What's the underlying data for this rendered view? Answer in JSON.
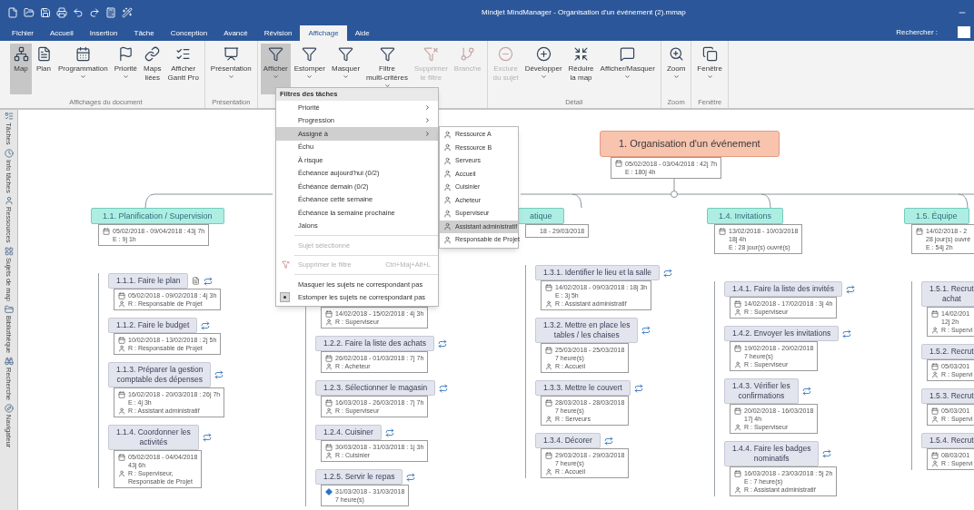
{
  "window": {
    "title": "Mindjet MindManager - Organisation d'un événement (2).mmap"
  },
  "menu_tabs": [
    {
      "label": "Fichier",
      "selected": false
    },
    {
      "label": "Accueil",
      "selected": false
    },
    {
      "label": "Insertion",
      "selected": false
    },
    {
      "label": "Tâche",
      "selected": false
    },
    {
      "label": "Conception",
      "selected": false
    },
    {
      "label": "Avancé",
      "selected": false
    },
    {
      "label": "Révision",
      "selected": false
    },
    {
      "label": "Affichage",
      "selected": true
    },
    {
      "label": "Aide",
      "selected": false
    }
  ],
  "search": {
    "label": "Rechercher :"
  },
  "ribbon": {
    "groups": [
      {
        "label": "Affichages du document",
        "buttons": [
          {
            "label": "Map",
            "dropdown": false,
            "selected": true,
            "disabled": false
          },
          {
            "label": "Plan",
            "dropdown": false,
            "selected": false,
            "disabled": false
          },
          {
            "label": "Programmation",
            "dropdown": true,
            "selected": false,
            "disabled": false
          },
          {
            "label": "Priorité",
            "dropdown": true,
            "selected": false,
            "disabled": false
          },
          {
            "label": "Maps\nliées",
            "dropdown": false,
            "selected": false,
            "disabled": false
          },
          {
            "label": "Afficher\nGantt Pro",
            "dropdown": false,
            "selected": false,
            "disabled": false
          }
        ]
      },
      {
        "label": "Présentation",
        "buttons": [
          {
            "label": "Présentation",
            "dropdown": true,
            "selected": false,
            "disabled": false
          }
        ]
      },
      {
        "buttons": [
          {
            "label": "Afficher",
            "dropdown": true,
            "selected": true,
            "disabled": false
          },
          {
            "label": "Estomper",
            "dropdown": true,
            "selected": false,
            "disabled": false
          },
          {
            "label": "Masquer",
            "dropdown": true,
            "selected": false,
            "disabled": false
          },
          {
            "label": "Filtre\nmulti-critères",
            "dropdown": true,
            "selected": false,
            "disabled": false
          },
          {
            "label": "Supprimer\nle filtre",
            "dropdown": false,
            "selected": false,
            "disabled": true
          },
          {
            "label": "Branche",
            "dropdown": false,
            "selected": false,
            "disabled": true
          }
        ]
      },
      {
        "label": "Détail",
        "buttons": [
          {
            "label": "Exclure\ndu sujet",
            "dropdown": false,
            "selected": false,
            "disabled": true
          },
          {
            "label": "Développer",
            "dropdown": true,
            "selected": false,
            "disabled": false
          },
          {
            "label": "Réduire\nla map",
            "dropdown": false,
            "selected": false,
            "disabled": false
          },
          {
            "label": "Afficher/Masquer",
            "dropdown": true,
            "selected": false,
            "disabled": false
          }
        ]
      },
      {
        "label": "Zoom",
        "buttons": [
          {
            "label": "Zoom",
            "dropdown": true,
            "selected": false,
            "disabled": false
          }
        ]
      },
      {
        "label": "Fenêtre",
        "buttons": [
          {
            "label": "Fenêtre",
            "dropdown": true,
            "selected": false,
            "disabled": false
          }
        ]
      }
    ]
  },
  "side_tabs": [
    "Tâches",
    "Info tâches",
    "Ressources",
    "Sujets de map",
    "Bibliothèque",
    "Recherche",
    "Navigateur"
  ],
  "filter_menu": {
    "heading": "Filtres des tâches",
    "items": [
      {
        "kind": "item",
        "label": "Priorité",
        "submenu": true,
        "selected": false,
        "disabled": false,
        "checked": false
      },
      {
        "kind": "item",
        "label": "Progression",
        "submenu": true,
        "selected": false,
        "disabled": false,
        "checked": false
      },
      {
        "kind": "item",
        "label": "Assigné à",
        "submenu": true,
        "selected": true,
        "disabled": false,
        "checked": false
      },
      {
        "kind": "item",
        "label": "Échu",
        "submenu": false,
        "selected": false,
        "disabled": false,
        "checked": false
      },
      {
        "kind": "item",
        "label": "À risque",
        "submenu": false,
        "selected": false,
        "disabled": false,
        "checked": false
      },
      {
        "kind": "item",
        "label": "Échéance aujourd'hui (0/2)",
        "submenu": false,
        "selected": false,
        "disabled": false,
        "checked": false
      },
      {
        "kind": "item",
        "label": "Échéance demain (0/2)",
        "submenu": false,
        "selected": false,
        "disabled": false,
        "checked": false
      },
      {
        "kind": "item",
        "label": "Échéance cette semaine",
        "submenu": false,
        "selected": false,
        "disabled": false,
        "checked": false
      },
      {
        "kind": "item",
        "label": "Échéance la semaine prochaine",
        "submenu": false,
        "selected": false,
        "disabled": false,
        "checked": false
      },
      {
        "kind": "item",
        "label": "Jalons",
        "submenu": false,
        "selected": false,
        "disabled": false,
        "checked": false
      },
      {
        "kind": "separator"
      },
      {
        "kind": "item",
        "label": "Sujet sélectionné",
        "submenu": false,
        "selected": false,
        "disabled": true,
        "checked": false
      },
      {
        "kind": "separator"
      },
      {
        "kind": "item",
        "label": "Supprimer le filtre",
        "shortcut": "Ctrl+Maj+Alt+L",
        "submenu": false,
        "selected": false,
        "disabled": true,
        "checked": false
      },
      {
        "kind": "separator"
      },
      {
        "kind": "item",
        "label": "Masquer les sujets ne correspondant pas",
        "submenu": false,
        "selected": false,
        "disabled": false,
        "checked": false
      },
      {
        "kind": "item",
        "label": "Estomper les sujets ne correspondant pas",
        "submenu": false,
        "selected": false,
        "disabled": false,
        "checked": true
      }
    ]
  },
  "assignee_submenu": {
    "items": [
      {
        "label": "Ressource A",
        "selected": false
      },
      {
        "label": "Ressource B",
        "selected": false
      },
      {
        "label": "Serveurs",
        "selected": false
      },
      {
        "label": "Accueil",
        "selected": false
      },
      {
        "label": "Cuisinier",
        "selected": false
      },
      {
        "label": "Acheteur",
        "selected": false
      },
      {
        "label": "Superviseur",
        "selected": false
      },
      {
        "label": "Assistant administratif",
        "selected": true
      },
      {
        "label": "Responsable de Projet",
        "selected": false
      }
    ]
  },
  "mind_map": {
    "central": {
      "title": "1. Organisation d'un événement",
      "info": [
        {
          "kind": "dates",
          "text": "05/02/2018 - 03/04/2018 : 42j 7h"
        },
        {
          "kind": "text",
          "text": "E : 180j 4h"
        }
      ]
    },
    "branches": [
      {
        "title": "1.1. Planification / Supervision",
        "info": [
          {
            "kind": "dates",
            "text": "05/02/2018 - 09/04/2018 : 43j 7h"
          },
          {
            "kind": "text",
            "text": "E : 9j 1h"
          }
        ],
        "children": [
          {
            "title": "1.1.1. Faire le plan",
            "note": true,
            "info": [
              {
                "kind": "dates",
                "text": "05/02/2018 - 09/02/2018 : 4j 3h"
              },
              {
                "kind": "resource",
                "text": "R : Responsable de Projet"
              }
            ]
          },
          {
            "title": "1.1.2. Faire le budget",
            "note": false,
            "info": [
              {
                "kind": "dates",
                "text": "10/02/2018 - 13/02/2018 : 2j 5h"
              },
              {
                "kind": "resource",
                "text": "R : Responsable de Projet"
              }
            ]
          },
          {
            "title": "1.1.3. Préparer la gestion\ncomptable des dépenses",
            "note": false,
            "info": [
              {
                "kind": "dates",
                "text": "16/02/2018 - 20/03/2018 : 26j 7h"
              },
              {
                "kind": "text",
                "text": "E : 4j 3h"
              },
              {
                "kind": "resource",
                "text": "R : Assistant administratif"
              }
            ]
          },
          {
            "title": "1.1.4. Coordonner les\nactivités",
            "note": false,
            "info": [
              {
                "kind": "dates",
                "text": "05/02/2018 - 04/04/2018"
              },
              {
                "kind": "text",
                "text": "43j 6h"
              },
              {
                "kind": "resource",
                "text": "R : Superviseur,"
              },
              {
                "kind": "text",
                "text": "Responsable de Projet"
              }
            ]
          }
        ]
      },
      {
        "children": [
          {
            "info": [
              {
                "kind": "dates",
                "text": "14/02/2018 - 15/02/2018 : 4j 3h"
              },
              {
                "kind": "resource",
                "text": "R : Superviseur"
              }
            ]
          },
          {
            "title": "1.2.2. Faire la liste des achats",
            "note": false,
            "info": [
              {
                "kind": "dates",
                "text": "26/02/2018 - 01/03/2018 : 7j 7h"
              },
              {
                "kind": "resource",
                "text": "R : Acheteur"
              }
            ]
          },
          {
            "title": "1.2.3. Sélectionner le magasin",
            "note": false,
            "info": [
              {
                "kind": "dates",
                "text": "16/03/2018 - 26/03/2018 : 7j 7h"
              },
              {
                "kind": "resource",
                "text": "R : Superviseur"
              }
            ]
          },
          {
            "title": "1.2.4. Cuisiner",
            "note": false,
            "info": [
              {
                "kind": "dates",
                "text": "30/03/2018 - 31/03/2018 : 1j 3h"
              },
              {
                "kind": "resource",
                "text": "R : Cuisinier"
              }
            ]
          },
          {
            "title": "1.2.5. Servir le repas",
            "note": false,
            "info": [
              {
                "kind": "milestone",
                "text": "31/03/2018 - 31/03/2018"
              },
              {
                "kind": "text",
                "text": "7 heure(s)"
              }
            ]
          }
        ]
      },
      {
        "title": "atique",
        "info": [
          {
            "kind": "text",
            "text": "18 - 29/03/2018"
          }
        ],
        "children": [
          {
            "title": "1.3.1. Identifier le lieu et la salle",
            "note": false,
            "info": [
              {
                "kind": "dates",
                "text": "14/02/2018 - 09/03/2018 : 18j 3h"
              },
              {
                "kind": "text",
                "text": "E : 3j 5h"
              },
              {
                "kind": "resource",
                "text": "R : Assistant administratif"
              }
            ]
          },
          {
            "title": "1.3.2. Mettre en place les\ntables / les chaises",
            "note": false,
            "info": [
              {
                "kind": "dates",
                "text": "25/03/2018 - 25/03/2018"
              },
              {
                "kind": "text",
                "text": "7 heure(s)"
              },
              {
                "kind": "resource",
                "text": "R : Accueil"
              }
            ]
          },
          {
            "title": "1.3.3. Mettre le couvert",
            "note": false,
            "info": [
              {
                "kind": "dates",
                "text": "28/03/2018 - 28/03/2018"
              },
              {
                "kind": "text",
                "text": "7 heure(s)"
              },
              {
                "kind": "resource",
                "text": "R : Serveurs"
              }
            ]
          },
          {
            "title": "1.3.4. Décorer",
            "note": false,
            "info": [
              {
                "kind": "dates",
                "text": "29/03/2018 - 29/03/2018"
              },
              {
                "kind": "text",
                "text": "7 heure(s)"
              },
              {
                "kind": "resource",
                "text": "R : Accueil"
              }
            ]
          }
        ]
      },
      {
        "title": "1.4. Invitations",
        "info": [
          {
            "kind": "dates",
            "text": "13/02/2018 - 10/03/2018"
          },
          {
            "kind": "text",
            "text": "18j 4h"
          },
          {
            "kind": "text",
            "text": "E : 28 jour(s) ouvré(s)"
          }
        ],
        "children": [
          {
            "title": "1.4.1. Faire la liste des invités",
            "note": false,
            "info": [
              {
                "kind": "dates",
                "text": "14/02/2018 - 17/02/2018 : 3j 4h"
              },
              {
                "kind": "resource",
                "text": "R : Superviseur"
              }
            ]
          },
          {
            "title": "1.4.2. Envoyer les invitations",
            "note": false,
            "info": [
              {
                "kind": "dates",
                "text": "19/02/2018 - 20/02/2018"
              },
              {
                "kind": "text",
                "text": "7 heure(s)"
              },
              {
                "kind": "resource",
                "text": "R : Superviseur"
              }
            ]
          },
          {
            "title": "1.4.3. Vérifier les\nconfirmations",
            "note": false,
            "info": [
              {
                "kind": "dates",
                "text": "20/02/2018 - 16/03/2018"
              },
              {
                "kind": "text",
                "text": "17j 4h"
              },
              {
                "kind": "resource",
                "text": "R : Superviseur"
              }
            ]
          },
          {
            "title": "1.4.4. Faire les badges\nnominatifs",
            "note": false,
            "info": [
              {
                "kind": "dates",
                "text": "16/03/2018 - 23/03/2018 : 5j 2h"
              },
              {
                "kind": "text",
                "text": "E : 7 heure(s)"
              },
              {
                "kind": "resource",
                "text": "R : Assistant administratif"
              }
            ]
          }
        ]
      },
      {
        "title": "1.5. Équipe",
        "info": [
          {
            "kind": "dates",
            "text": "14/02/2018 - 2"
          },
          {
            "kind": "text",
            "text": "28 jour(s) ouvré"
          },
          {
            "kind": "text",
            "text": "E : 54j 2h"
          }
        ],
        "children": [
          {
            "title": "1.5.1. Recrut\nachat",
            "info": [
              {
                "kind": "dates",
                "text": "14/02/201"
              },
              {
                "kind": "text",
                "text": "12j 2h"
              },
              {
                "kind": "resource",
                "text": "R : Supervi"
              }
            ]
          },
          {
            "title": "1.5.2. Recrut",
            "info": [
              {
                "kind": "dates",
                "text": "05/03/201"
              },
              {
                "kind": "resource",
                "text": "R : Supervi"
              }
            ]
          },
          {
            "title": "1.5.3. Recrut",
            "info": [
              {
                "kind": "dates",
                "text": "05/03/201"
              },
              {
                "kind": "resource",
                "text": "R : Supervi"
              }
            ]
          },
          {
            "title": "1.5.4. Recrut",
            "info": [
              {
                "kind": "dates",
                "text": "08/03/201"
              },
              {
                "kind": "resource",
                "text": "R : Supervi"
              }
            ]
          }
        ]
      }
    ]
  }
}
